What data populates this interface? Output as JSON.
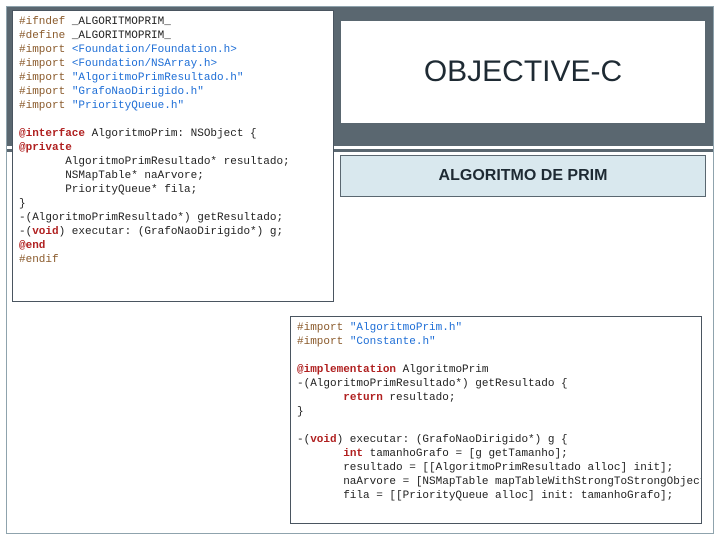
{
  "header": {
    "title": "OBJECTIVE-C",
    "subtitle": "ALGORITMO DE PRIM"
  },
  "code1": {
    "l1a": "#ifndef",
    "l1b": "_ALGORITMOPRIM_",
    "l2a": "#define",
    "l2b": "_ALGORITMOPRIM_",
    "l3a": "#import",
    "l3b": "<Foundation/Foundation.h>",
    "l4a": "#import",
    "l4b": "<Foundation/NSArray.h>",
    "l5a": "#import",
    "l5b": "\"AlgoritmoPrimResultado.h\"",
    "l6a": "#import",
    "l6b": "\"GrafoNaoDirigido.h\"",
    "l7a": "#import",
    "l7b": "\"PriorityQueue.h\"",
    "l8a": "@interface",
    "l8b": " AlgoritmoPrim: NSObject {",
    "l9": "@private",
    "l10": "       AlgoritmoPrimResultado* resultado;",
    "l11": "       NSMapTable* naArvore;",
    "l12": "       PriorityQueue* fila;",
    "l13": "}",
    "l14": "-(AlgoritmoPrimResultado*) getResultado;",
    "l15a": "-(",
    "l15b": "void",
    "l15c": ") executar: (GrafoNaoDirigido*) g;",
    "l16": "@end",
    "l17": "#endif"
  },
  "code2": {
    "l1a": "#import",
    "l1b": "\"AlgoritmoPrim.h\"",
    "l2a": "#import",
    "l2b": "\"Constante.h\"",
    "l3a": "@implementation",
    "l3b": " AlgoritmoPrim",
    "l4": "-(AlgoritmoPrimResultado*) getResultado {",
    "l5a": "       ",
    "l5b": "return",
    "l5c": " resultado;",
    "l6": "}",
    "l7a": "-(",
    "l7b": "void",
    "l7c": ") executar: (GrafoNaoDirigido*) g {",
    "l8a": "       ",
    "l8b": "int",
    "l8c": " tamanhoGrafo = [g getTamanho];",
    "l9": "       resultado = [[AlgoritmoPrimResultado alloc] init];",
    "l10": "       naArvore = [NSMapTable mapTableWithStrongToStrongObjects];",
    "l11": "       fila = [[PriorityQueue alloc] init: tamanhoGrafo];"
  }
}
